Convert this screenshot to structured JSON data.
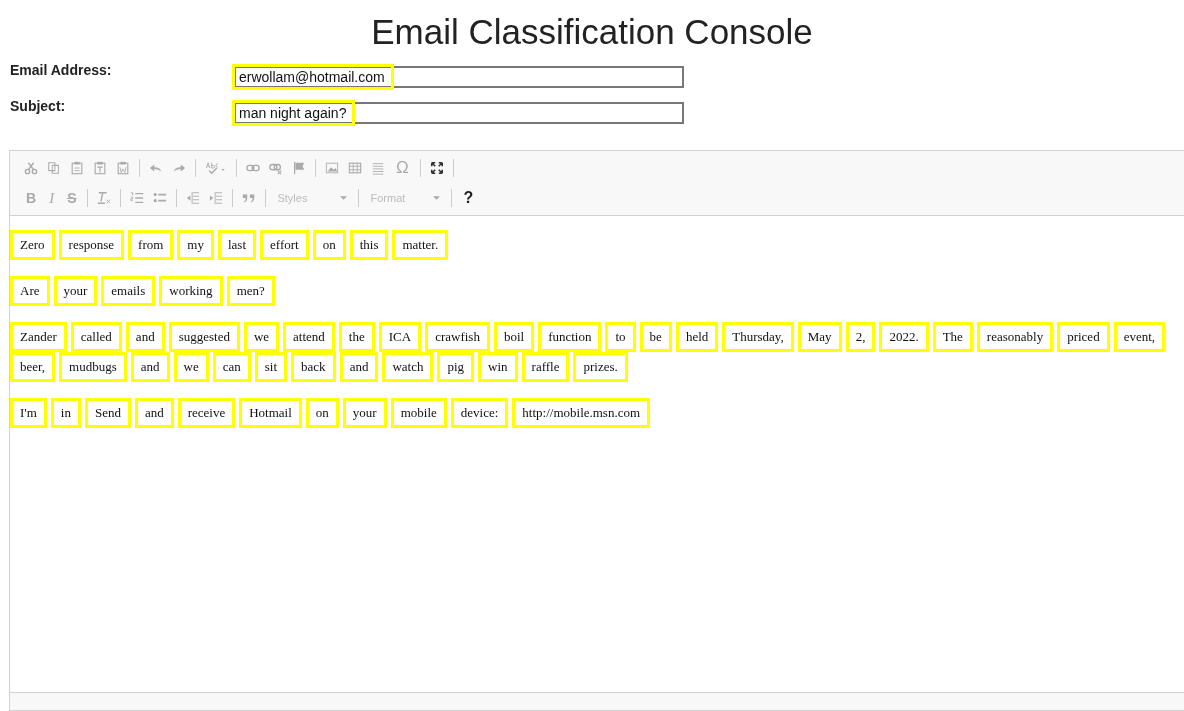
{
  "title": "Email Classification Console",
  "fields": [
    {
      "label": "Email Address:",
      "value": "erwollam@hotmail.com"
    },
    {
      "label": "Subject:",
      "value": "man night again?"
    }
  ],
  "toolbar": {
    "bold": "B",
    "italic": "I",
    "strike": "S",
    "special_char": "Ω",
    "styles": "Styles",
    "format": "Format",
    "help": "?"
  },
  "body": [
    [
      "Zero",
      "response",
      "from",
      "my",
      "last",
      "effort",
      "on",
      "this",
      "matter."
    ],
    [
      "Are",
      "your",
      "emails",
      "working",
      "men?"
    ],
    [
      "Zander",
      "called",
      "and",
      "suggested",
      "we",
      "attend",
      "the",
      "ICA",
      "crawfish",
      "boil",
      "function",
      "to",
      "be",
      "held",
      "Thursday,",
      "May",
      "2,",
      "2022.",
      "The",
      "reasonably",
      "priced",
      "event,",
      "beer,",
      "mudbugs",
      "and",
      "we",
      "can",
      "sit",
      "back",
      "and",
      "watch",
      "pig",
      "win",
      "raffle",
      "prizes."
    ],
    [
      "I'm",
      "in",
      "Send",
      "and",
      "receive",
      "Hotmail",
      "on",
      "your",
      "mobile",
      "device:",
      "http://mobile.msn.com"
    ]
  ]
}
